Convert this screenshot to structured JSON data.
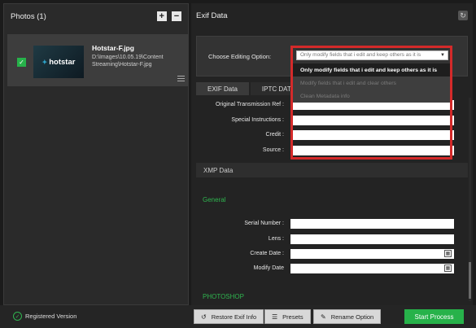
{
  "left_panel": {
    "title": "Photos (1)",
    "add_label": "+",
    "remove_label": "−",
    "photo": {
      "name": "Hotstar-F.jpg",
      "path": "D:\\Images\\10.05.19\\Content Streaming\\Hotstar-F.jpg",
      "thumb_text": "hotstar",
      "checked": true
    }
  },
  "right_panel": {
    "title": "Exif Data",
    "option_label": "Choose Editing Option:",
    "tabs": [
      {
        "label": "EXIF Data"
      },
      {
        "label": "IPTC DATA"
      }
    ],
    "fields_top": [
      {
        "label": "Original Transmission Ref :"
      },
      {
        "label": "Special Instructions :"
      },
      {
        "label": "Credit :"
      },
      {
        "label": "Source :"
      }
    ],
    "xmp_label": "XMP Data",
    "general_label": "General",
    "fields_general": [
      {
        "label": "Serial Number :"
      },
      {
        "label": "Lens :"
      },
      {
        "label": "Create Date :"
      },
      {
        "label": "Modify Date"
      }
    ],
    "photoshop_label": "PHOTOSHOP"
  },
  "dropdown": {
    "selected": "Only modify fields that i edit and keep others as it is",
    "options": [
      "Only modify fields that i edit and keep others as it is",
      "Modify fields that i edit and clear others",
      "Clean Metadata info"
    ]
  },
  "bottom_bar": {
    "registered": "Registered Version",
    "restore": "Restore Exif Info",
    "presets": "Presets",
    "rename": "Rename Option",
    "start": "Start Process"
  },
  "colors": {
    "accent_green": "#27b24a",
    "highlight_red": "#d42a2a"
  }
}
